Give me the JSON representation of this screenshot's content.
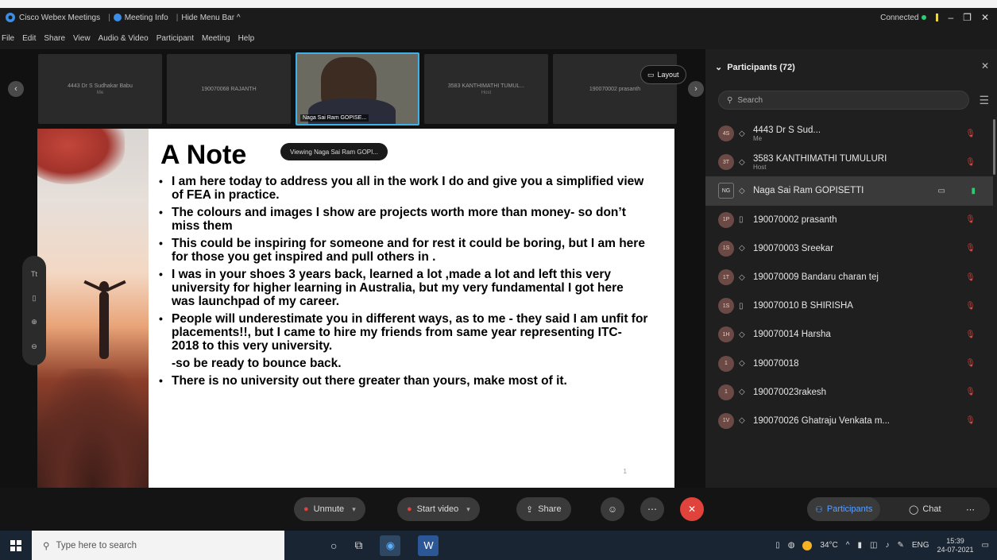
{
  "titlebar": {
    "app_name": "Cisco Webex Meetings",
    "meeting_info": "Meeting Info",
    "hide_menu": "Hide Menu Bar ^",
    "status": "Connected",
    "minimize": "–",
    "restore": "❐",
    "close": "✕"
  },
  "menu": [
    "File",
    "Edit",
    "Share",
    "View",
    "Audio & Video",
    "Participant",
    "Meeting",
    "Help"
  ],
  "video_strip": {
    "prev": "‹",
    "next": "›",
    "thumbs": [
      {
        "name": "4443 Dr S Sudhakar Babu",
        "role": "Me"
      },
      {
        "name": "190070068 RAJANTH",
        "role": ""
      },
      {
        "name": "Naga Sai Ram GOPISE...",
        "role": ""
      },
      {
        "name": "3583 KANTHIMATHI TUMUL...",
        "role": "Host"
      },
      {
        "name": "190070002 prasanth",
        "role": ""
      }
    ],
    "layout_label": "Layout"
  },
  "slide": {
    "title": "A Note",
    "viewing": "Viewing Naga Sai Ram GOPI...",
    "bullets": [
      "I am here today to address you all in the work I do and give you a simplified view of FEA in practice.",
      "The colours and images I show are projects worth more than money- so don’t miss them",
      "This could be inspiring for someone and for rest it could be boring, but I am here for those you get inspired and pull others in .",
      "I was in your shoes 3 years back, learned a lot ,made a lot and left this very university for higher learning in Australia, but my very fundamental I got here was launchpad of my career.",
      "People will underestimate you in different ways, as to me - they said I am unfit for placements!!, but I came to hire my friends from same year representing ITC-2018 to this very university.",
      "-so be ready to bounce back.",
      "There is no university out there greater than yours, make most of it."
    ],
    "page_marker": "1"
  },
  "participants": {
    "header": "Participants (72)",
    "close": "✕",
    "search_placeholder": "Search",
    "list": [
      {
        "initials": "4S",
        "name": "4443 Dr S Sud...",
        "role": "Me",
        "device": "◇"
      },
      {
        "initials": "3T",
        "name": "3583 KANTHIMATHI TUMULURI",
        "role": "Host",
        "device": "◇"
      },
      {
        "initials": "NG",
        "name": "Naga Sai Ram GOPISETTI",
        "role": "",
        "device": "◇"
      },
      {
        "initials": "1P",
        "name": "190070002 prasanth",
        "role": "",
        "device": "▯"
      },
      {
        "initials": "1S",
        "name": "190070003 Sreekar",
        "role": "",
        "device": "◇"
      },
      {
        "initials": "1T",
        "name": "190070009 Bandaru charan tej",
        "role": "",
        "device": "◇"
      },
      {
        "initials": "1S",
        "name": "190070010 B SHIRISHA",
        "role": "",
        "device": "▯"
      },
      {
        "initials": "1H",
        "name": "190070014 Harsha",
        "role": "",
        "device": "◇"
      },
      {
        "initials": "1",
        "name": "190070018",
        "role": "",
        "device": "◇"
      },
      {
        "initials": "1",
        "name": "190070023rakesh",
        "role": "",
        "device": "◇"
      },
      {
        "initials": "1V",
        "name": "190070026 Ghatraju Venkata m...",
        "role": "",
        "device": "◇"
      }
    ]
  },
  "controls": {
    "unmute": "Unmute",
    "start_video": "Start video",
    "share": "Share",
    "participants": "Participants",
    "chat": "Chat"
  },
  "taskbar": {
    "search_placeholder": "Type here to search",
    "temperature": "34°C",
    "language": "ENG",
    "time": "15:39",
    "date": "24-07-2021"
  },
  "colors": {
    "accent": "#3fb0e8",
    "leave_red": "#e0433b",
    "connected_green": "#2ecc71"
  }
}
